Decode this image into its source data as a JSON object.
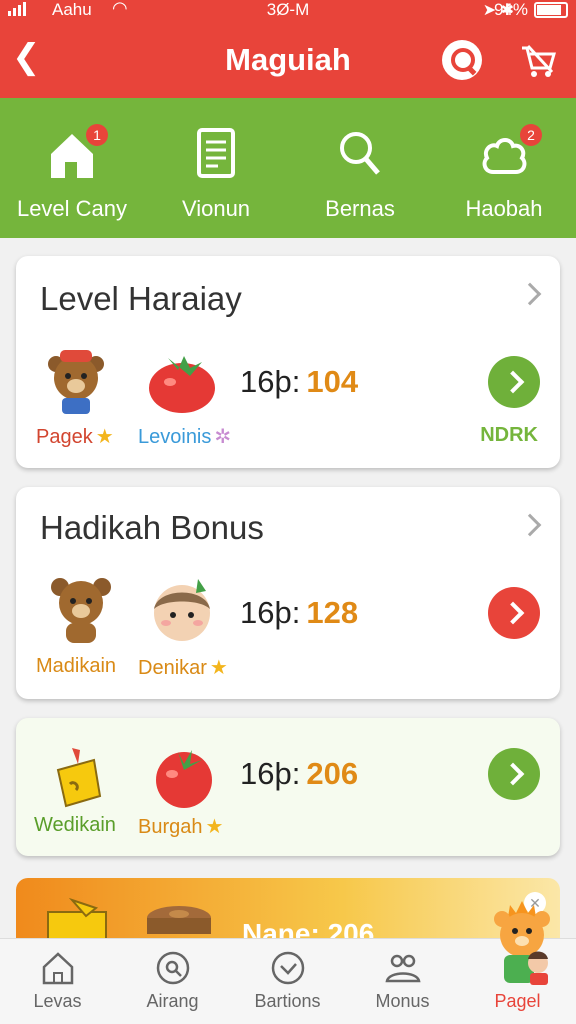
{
  "status_bar": {
    "carrier": "Aahu",
    "time": "3Ø-M",
    "battery": "94%"
  },
  "header": {
    "title": "Maguiah",
    "back_icon": "chevron-left-icon",
    "actions": [
      "search-icon",
      "cart-icon"
    ],
    "background_color": "#e8443a"
  },
  "category_nav": {
    "background_color": "#75b53c",
    "items": [
      {
        "label": "Level Cany",
        "icon": "home-icon",
        "badge": "1"
      },
      {
        "label": "Vionun",
        "icon": "document-icon",
        "badge": ""
      },
      {
        "label": "Bernas",
        "icon": "magnifier-icon",
        "badge": ""
      },
      {
        "label": "Haobah",
        "icon": "cloud-icon",
        "badge": "2"
      }
    ]
  },
  "cards": [
    {
      "title": "Level Haraiay",
      "stat_label": "16þ:",
      "stat_value": "104",
      "tags": [
        "Pagek",
        "Levoinis"
      ],
      "right_label": "NDRK",
      "action_color": "#6fb03a"
    },
    {
      "title": "Hadikah Bonus",
      "stat_label": "16þ:",
      "stat_value": "128",
      "tags": [
        "Madikain",
        "Denikar"
      ],
      "action_color": "#e8443a"
    },
    {
      "title": "",
      "stat_label": "16þ:",
      "stat_value": "206",
      "tags": [
        "Wedikain",
        "Burgah"
      ],
      "action_color": "#6fb03a"
    }
  ],
  "promo": {
    "text": "Nane: 206"
  },
  "bottom_nav": {
    "items": [
      {
        "label": "Levas",
        "icon": "home-outline-icon"
      },
      {
        "label": "Airang",
        "icon": "search-circle-icon"
      },
      {
        "label": "Bartions",
        "icon": "check-circle-icon"
      },
      {
        "label": "Monus",
        "icon": "people-icon"
      },
      {
        "label": "Pagel",
        "icon": "bear-avatar-icon",
        "active": true
      }
    ]
  }
}
